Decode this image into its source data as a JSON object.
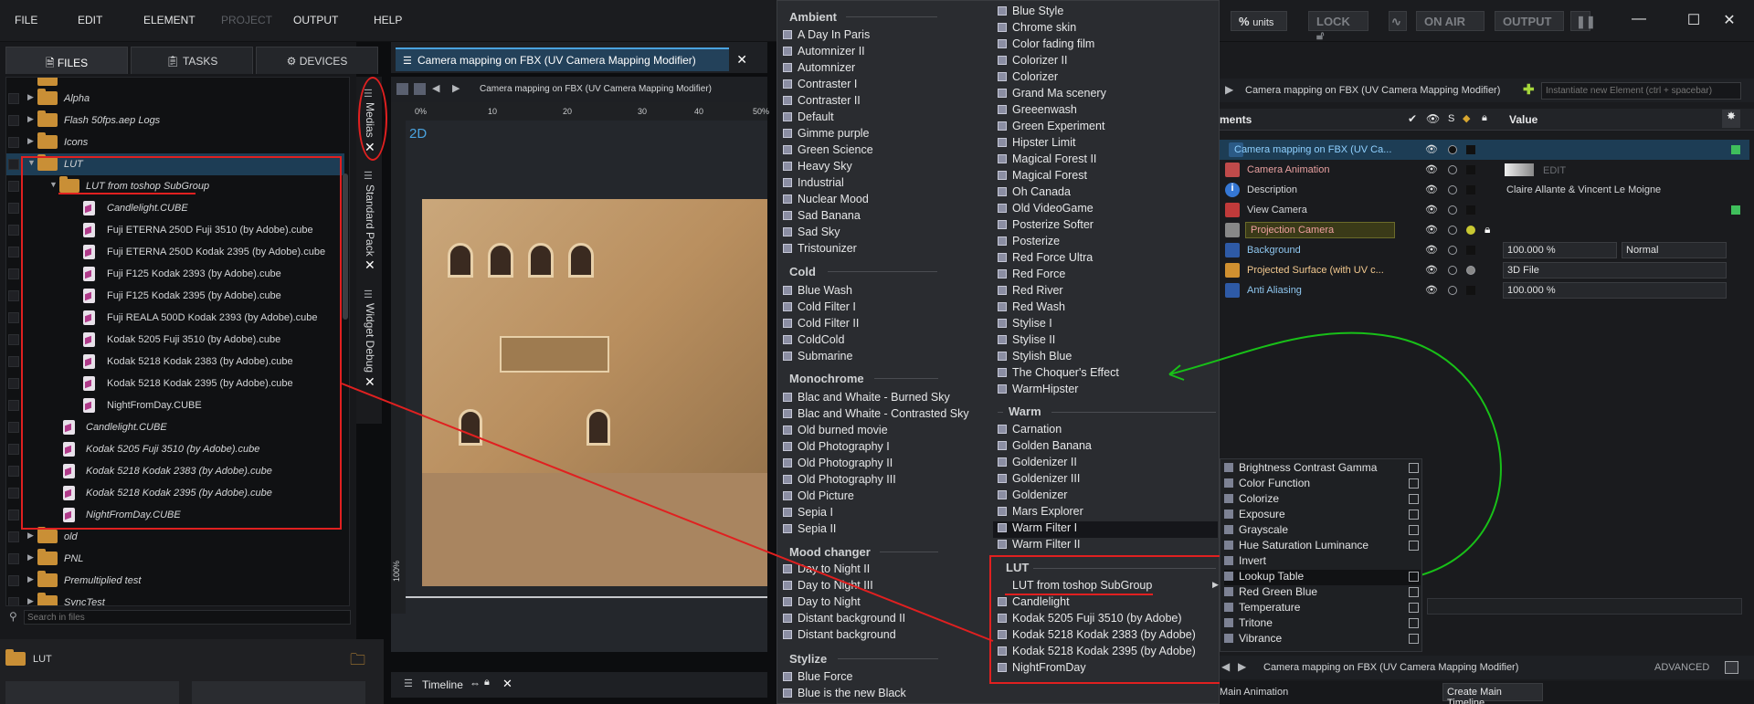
{
  "menubar": {
    "items": [
      "FILE",
      "EDIT",
      "ELEMENT",
      "PROJECT",
      "OUTPUT",
      "HELP"
    ],
    "units_label": "units",
    "units_symbol": "%",
    "lock_label": "LOCK",
    "onair_label": "ON AIR",
    "output_label": "OUTPUT"
  },
  "left_tabs": [
    "FILES",
    "TASKS",
    "DEVICES"
  ],
  "file_tree": {
    "rows": [
      {
        "label": "Alpha",
        "type": "folder"
      },
      {
        "label": "Flash 50fps.aep Logs",
        "type": "folder"
      },
      {
        "label": "Icons",
        "type": "folder"
      },
      {
        "label": "LUT",
        "type": "folder"
      },
      {
        "label": "LUT from toshop SubGroup",
        "type": "folder"
      },
      {
        "label": "Candlelight.CUBE",
        "type": "cube"
      },
      {
        "label": "Fuji ETERNA 250D Fuji 3510 (by Adobe).cube",
        "type": "cube"
      },
      {
        "label": "Fuji ETERNA 250D Kodak 2395 (by Adobe).cube",
        "type": "cube"
      },
      {
        "label": "Fuji F125 Kodak 2393 (by Adobe).cube",
        "type": "cube"
      },
      {
        "label": "Fuji F125 Kodak 2395 (by Adobe).cube",
        "type": "cube"
      },
      {
        "label": "Fuji REALA 500D Kodak 2393 (by Adobe).cube",
        "type": "cube"
      },
      {
        "label": "Kodak 5205 Fuji 3510 (by Adobe).cube",
        "type": "cube"
      },
      {
        "label": "Kodak 5218 Kodak 2383 (by Adobe).cube",
        "type": "cube"
      },
      {
        "label": "Kodak 5218 Kodak 2395 (by Adobe).cube",
        "type": "cube"
      },
      {
        "label": "NightFromDay.CUBE",
        "type": "cube"
      },
      {
        "label": "Candlelight.CUBE",
        "type": "cube"
      },
      {
        "label": "Kodak 5205 Fuji 3510 (by Adobe).cube",
        "type": "cube"
      },
      {
        "label": "Kodak 5218 Kodak 2383 (by Adobe).cube",
        "type": "cube"
      },
      {
        "label": "Kodak 5218 Kodak 2395 (by Adobe).cube",
        "type": "cube"
      },
      {
        "label": "NightFromDay.CUBE",
        "type": "cube"
      },
      {
        "label": "old",
        "type": "folder"
      },
      {
        "label": "PNL",
        "type": "folder"
      },
      {
        "label": "Premultiplied test",
        "type": "folder"
      },
      {
        "label": "SyncTest",
        "type": "folder"
      }
    ],
    "search_placeholder": "Search in files",
    "current_folder": "LUT"
  },
  "side_tabs": {
    "medias": "Medias",
    "standard_pack": "Standard Pack",
    "widget_debug": "Widget Debug"
  },
  "viewport": {
    "tab_title": "Camera mapping on FBX (UV Camera Mapping Modifier)",
    "toolbar_title": "Camera mapping on FBX (UV Camera Mapping Modifier)",
    "mode": "2D",
    "ruler_top": [
      "0%",
      "10",
      "20",
      "30",
      "40",
      "50%"
    ],
    "ruler_left": "100%",
    "timeline_label": "Timeline"
  },
  "dropdown": {
    "col1": [
      {
        "head": "Ambient",
        "items": [
          "A Day In Paris",
          "Automnizer II",
          "Automnizer",
          "Contraster I",
          "Contraster II",
          "Default",
          "Gimme purple",
          "Green Science",
          "Heavy Sky",
          "Industrial",
          "Nuclear Mood",
          "Sad Banana",
          "Sad Sky",
          "Tristounizer"
        ]
      },
      {
        "head": "Cold",
        "items": [
          "Blue Wash",
          "Cold Filter I",
          "Cold Filter II",
          "ColdCold",
          "Submarine"
        ]
      },
      {
        "head": "Monochrome",
        "items": [
          "Blac and Whaite - Burned Sky",
          "Blac and Whaite - Contrasted Sky",
          "Old burned movie",
          "Old Photography I",
          "Old Photography II",
          "Old Photography III",
          "Old Picture",
          "Sepia I",
          "Sepia II"
        ]
      },
      {
        "head": "Mood changer",
        "items": [
          "Day to Night II",
          "Day to Night III",
          "Day to Night",
          "Distant background II",
          "Distant background"
        ]
      },
      {
        "head": "Stylize",
        "items": [
          "Blue Force",
          "Blue is the new Black"
        ]
      }
    ],
    "col2_top": [
      "Blue Style",
      "Chrome skin",
      "Color fading film",
      "Colorizer II",
      "Colorizer",
      "Grand Ma scenery",
      "Greeenwash",
      "Green Experiment",
      "Hipster Limit",
      "Magical Forest II",
      "Magical Forest",
      "Oh Canada",
      "Old VideoGame",
      "Posterize Softer",
      "Posterize",
      "Red Force Ultra",
      "Red Force",
      "Red River",
      "Red Wash",
      "Stylise I",
      "Stylise II",
      "Stylish Blue",
      "The Choquer's Effect",
      "WarmHipster"
    ],
    "warm": {
      "head": "Warm",
      "items": [
        "Carnation",
        "Golden Banana",
        "Goldenizer II",
        "Goldenizer III",
        "Goldenizer",
        "Mars Explorer",
        "Warm Filter I",
        "Warm Filter II"
      ]
    },
    "lut": {
      "head": "LUT",
      "items": [
        "LUT from toshop SubGroup",
        "Candlelight",
        "Kodak 5205 Fuji 3510 (by Adobe)",
        "Kodak 5218 Kodak 2383 (by Adobe)",
        "Kodak 5218 Kodak 2395 (by Adobe)",
        "NightFromDay"
      ]
    }
  },
  "properties": {
    "toolbar_title": "Camera mapping on FBX (UV Camera Mapping Modifier)",
    "instantiate_placeholder": "Instantiate new Element (ctrl + spacebar)",
    "header_elements": "ments",
    "header_s": "S",
    "header_value": "Value",
    "rows": [
      {
        "label": "Camera mapping on FBX (UV Ca...",
        "value": "",
        "color": "#6fb3e6"
      },
      {
        "label": "Camera Animation",
        "value": "EDIT",
        "color": "#e8a0a0"
      },
      {
        "label": "Description",
        "value": "Claire Allante & Vincent Le Moigne",
        "color": "#ffffff"
      },
      {
        "label": "View Camera",
        "value": "",
        "color": "#ffffff"
      },
      {
        "label": "Projection Camera",
        "value": "",
        "color": "#f0a0a0"
      },
      {
        "label": "Background",
        "value": "100.000 %",
        "value2": "Normal",
        "color": "#8fc7f0"
      },
      {
        "label": "Projected Surface (with UV c...",
        "value": "3D File",
        "color": "#f3c98f"
      },
      {
        "label": "Anti Aliasing",
        "value": "100.000 %",
        "color": "#8fc7f0"
      }
    ],
    "effects": [
      "Brightness Contrast Gamma",
      "Color Function",
      "Colorize",
      "Exposure",
      "Grayscale",
      "Hue Saturation Luminance",
      "Invert",
      "Lookup Table",
      "Red Green Blue",
      "Temperature",
      "Tritone",
      "Vibrance"
    ],
    "bottom_title": "Camera mapping on FBX (UV Camera Mapping Modifier)",
    "advanced_label": "ADVANCED",
    "main_animation": "Main Animation",
    "create_main_timeline": "Create Main Timeline"
  }
}
